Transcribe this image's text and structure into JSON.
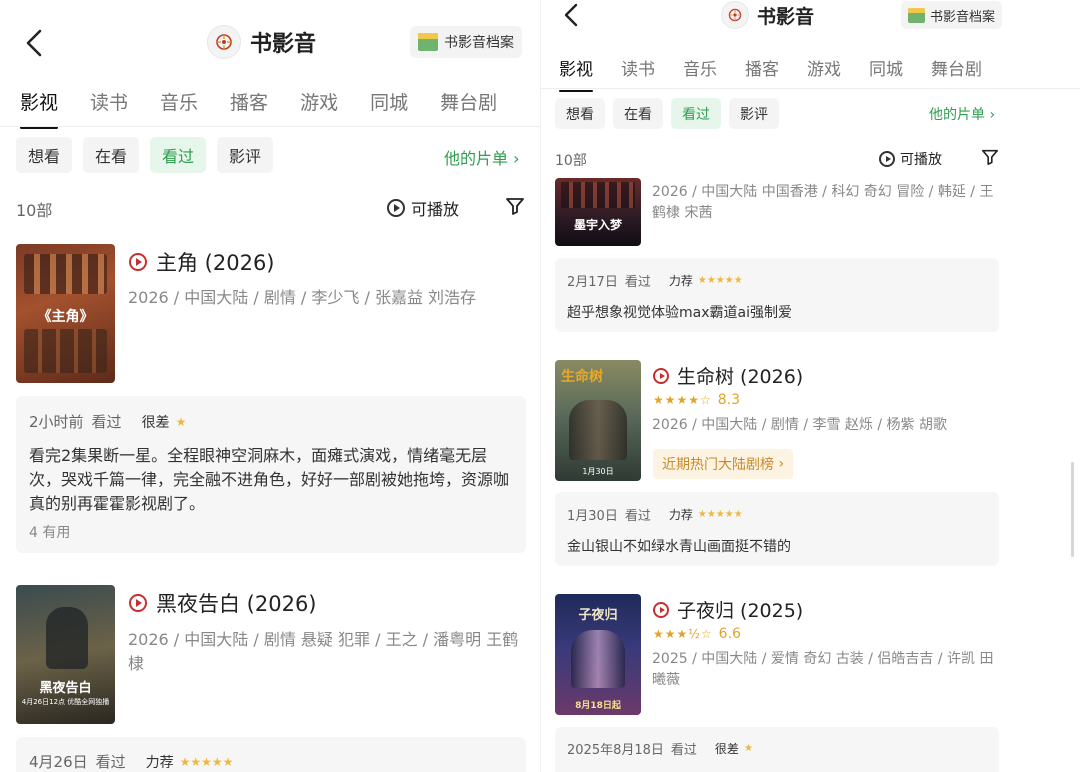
{
  "header": {
    "title": "书影音",
    "archive_label": "书影音档案"
  },
  "tabs": [
    "影视",
    "读书",
    "音乐",
    "播客",
    "游戏",
    "同城",
    "舞台剧"
  ],
  "chips": [
    "想看",
    "在看",
    "看过",
    "影评"
  ],
  "his_list_label": "他的片单",
  "count_label": "10部",
  "playable_label": "可播放",
  "left_items": [
    {
      "title": "主角 (2026)",
      "meta": "2026 / 中国大陆 / 剧情 / 李少飞 / 张嘉益 刘浩存",
      "poster_text": "《主角》",
      "review_time": "2小时前",
      "review_status": "看过",
      "review_level": "很差",
      "review_stars": "★",
      "review_text": "看完2集果断一星。全程眼神空洞麻木，面瘫式演戏，情绪毫无层次，哭戏千篇一律，完全融不进角色，好好一部剧被她拖垮，资源咖真的别再霍霍影视剧了。",
      "useful": "4 有用"
    },
    {
      "title": "黑夜告白 (2026)",
      "meta": "2026 / 中国大陆 / 剧情 悬疑 犯罪 / 王之 / 潘粤明 王鹤棣",
      "poster_text": "黑夜告白",
      "poster_date": "4月26日12点 优酷全网独播",
      "review_time": "4月26日",
      "review_status": "看过",
      "review_level": "力荐",
      "review_stars": "★★★★★"
    }
  ],
  "right_items": [
    {
      "meta": "2026 / 中国大陆 中国香港 / 科幻 奇幻 冒险 / 韩延 / 王鹤棣 宋茜",
      "poster_text": "墨宇入梦",
      "review_time": "2月17日",
      "review_status": "看过",
      "review_level": "力荐",
      "review_stars": "★★★★★",
      "review_text": "超乎想象视觉体验max霸道ai强制爱"
    },
    {
      "title": "生命树 (2026)",
      "rating_stars": "★★★★☆",
      "rating": "8.3",
      "meta": "2026 / 中国大陆 / 剧情 / 李雪 赵烁 / 杨紫 胡歌",
      "rank_badge": "近期热门大陆剧榜",
      "poster_text": "生命树",
      "poster_date": "1月30日",
      "review_time": "1月30日",
      "review_status": "看过",
      "review_level": "力荐",
      "review_stars": "★★★★★",
      "review_text": "金山银山不如绿水青山画面挺不错的"
    },
    {
      "title": "子夜归 (2025)",
      "rating_stars": "★★★½☆",
      "rating": "6.6",
      "meta": "2025 / 中国大陆 / 爱情 奇幻 古装 / 侣皓吉吉 / 许凯 田曦薇",
      "poster_text": "子夜归",
      "poster_date": "8月18日起",
      "review_time": "2025年8月18日",
      "review_status": "看过",
      "review_level": "很差",
      "review_stars": "★"
    }
  ],
  "colors": {
    "accent_green": "#2f9e4f",
    "play_red": "#c62f2f",
    "star_gold": "#f0b83a"
  }
}
